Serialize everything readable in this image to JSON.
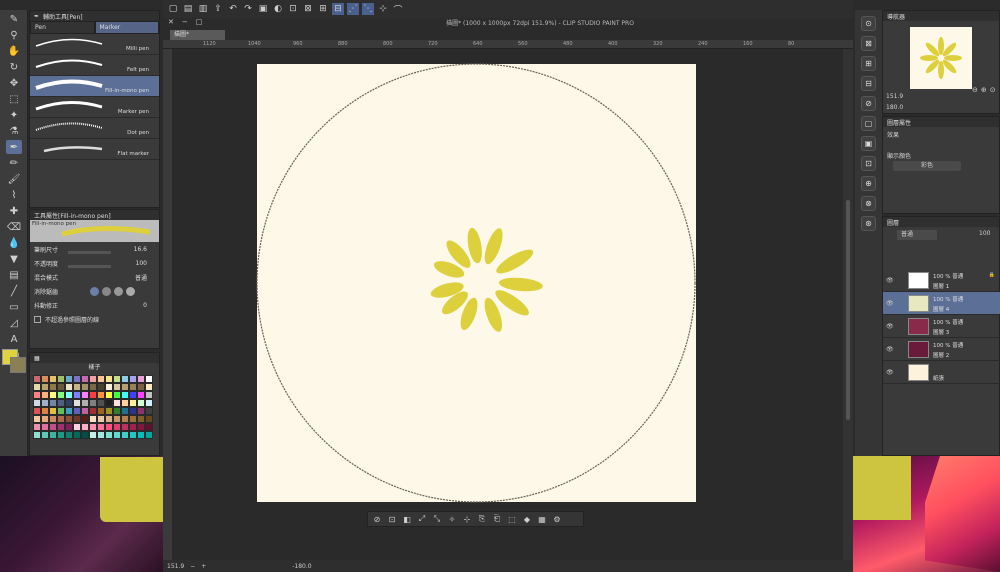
{
  "app_title": "描圖* (1000 x 1000px 72dpi 151.9%) - CLIP STUDIO PAINT PRO",
  "doc_tab": "描圖*",
  "subtool_panel": {
    "title": "輔助工具[Pen]",
    "tabs": [
      "Pen",
      "Marker"
    ],
    "brushes": [
      "Milli pen",
      "Felt pen",
      "Fill-in-mono pen",
      "Marker pen",
      "Dot pen",
      "Flat marker"
    ],
    "selected_brush": "Fill-in-mono pen"
  },
  "tool_property": {
    "title": "工具屬性[Fill-in-mono pen]",
    "preview_label": "Fill-in-mono pen",
    "brush_size_label": "筆刷尺寸",
    "brush_size_value": "16.6",
    "opacity_label": "不透明度",
    "opacity_value": "100",
    "blend_label": "混合模式",
    "blend_value": "普通",
    "antialias_label": "消除鋸齒",
    "stabilization_label": "抖動修正",
    "stabilization_value": "0",
    "ref_label": "不超過參照圖層的線"
  },
  "color_set": {
    "name": "樣子",
    "swatches": [
      "#c86a6a",
      "#d98f5c",
      "#e3c36a",
      "#9fbf6a",
      "#6aa9c8",
      "#7c72c8",
      "#c86ab0",
      "#f0a0a0",
      "#f5c48f",
      "#f7e28f",
      "#c4e08f",
      "#8fd0e8",
      "#a79ff0",
      "#e89fd6",
      "#ffffff",
      "#e3d9a8",
      "#b9a46a",
      "#8f7a48",
      "#6a5a3a",
      "#efe3c6",
      "#c8b48a",
      "#a69068",
      "#7a6a4a",
      "#4a4032",
      "#f8f0d8",
      "#d8c8a0",
      "#b8a070",
      "#988058",
      "#786040",
      "#ffe8c0",
      "#ff8080",
      "#ffb080",
      "#ffff80",
      "#80ff80",
      "#80ffff",
      "#8080ff",
      "#ff80ff",
      "#ff4040",
      "#ff9040",
      "#ffff40",
      "#40ff40",
      "#40ffff",
      "#4040ff",
      "#ff40ff",
      "#c0c0c0",
      "#d0d8e8",
      "#a0b0c8",
      "#7088a8",
      "#506080",
      "#304060",
      "#e0e0e0",
      "#b0b0b0",
      "#808080",
      "#505050",
      "#202020",
      "#ffe0e0",
      "#ffd0a0",
      "#fff0a0",
      "#d0ffd0",
      "#d0f0ff",
      "#e05050",
      "#e08040",
      "#e0c040",
      "#60c060",
      "#40a0c0",
      "#6060c0",
      "#c060a0",
      "#a03030",
      "#a06020",
      "#a09020",
      "#308030",
      "#207090",
      "#303090",
      "#903070",
      "#404040",
      "#f4c8a0",
      "#e8a878",
      "#d08860",
      "#b06848",
      "#905038",
      "#703828",
      "#502018",
      "#f8e0c8",
      "#ecc8a8",
      "#dcb088",
      "#c89868",
      "#b08050",
      "#987038",
      "#806028",
      "#684818",
      "#f090b0",
      "#e070a0",
      "#c05088",
      "#a03070",
      "#802058",
      "#ffd0e0",
      "#ffb0c8",
      "#ff90b0",
      "#ff7098",
      "#ff5080",
      "#e04070",
      "#c03060",
      "#a02050",
      "#801840",
      "#601030",
      "#90e0d0",
      "#60c8b8",
      "#40b0a0",
      "#209888",
      "#108070",
      "#006858",
      "#005048",
      "#c0f0e8",
      "#a0e8e0",
      "#80e0d8",
      "#60d8d0",
      "#40d0c8",
      "#20c8c0",
      "#00c0b8",
      "#00a8a0"
    ]
  },
  "canvas": {
    "ruler_marks": [
      "1120",
      "1040",
      "960",
      "880",
      "800",
      "720",
      "640",
      "560",
      "480",
      "400",
      "320",
      "240",
      "160",
      "80"
    ],
    "zoom": "151.9",
    "rotation": "-180.0"
  },
  "chart_data": {
    "type": "flower",
    "petal_color": "#ddd03c",
    "paper_color": "#fdf8e8",
    "circle_color": "#6a6055"
  },
  "navigator": {
    "title": "導航器",
    "zoom": "151.9",
    "angle": "180.0"
  },
  "layer_property": {
    "title": "圖層屬性",
    "effect_label": "效果",
    "display_color_label": "顯示顏色",
    "display_color_value": "彩色"
  },
  "layer_panel": {
    "title": "圖層",
    "blend_value": "普通",
    "opacity_value": "100",
    "layers": [
      {
        "pct": "100 % 普通",
        "name": "圖層 1",
        "locked": "🔒"
      },
      {
        "pct": "100 % 普通",
        "name": "圖層 4",
        "locked": ""
      },
      {
        "pct": "100 % 普通",
        "name": "圖層 3",
        "locked": ""
      },
      {
        "pct": "100 % 普通",
        "name": "圖層 2",
        "locked": ""
      },
      {
        "pct": "",
        "name": "紙張",
        "locked": ""
      }
    ]
  }
}
